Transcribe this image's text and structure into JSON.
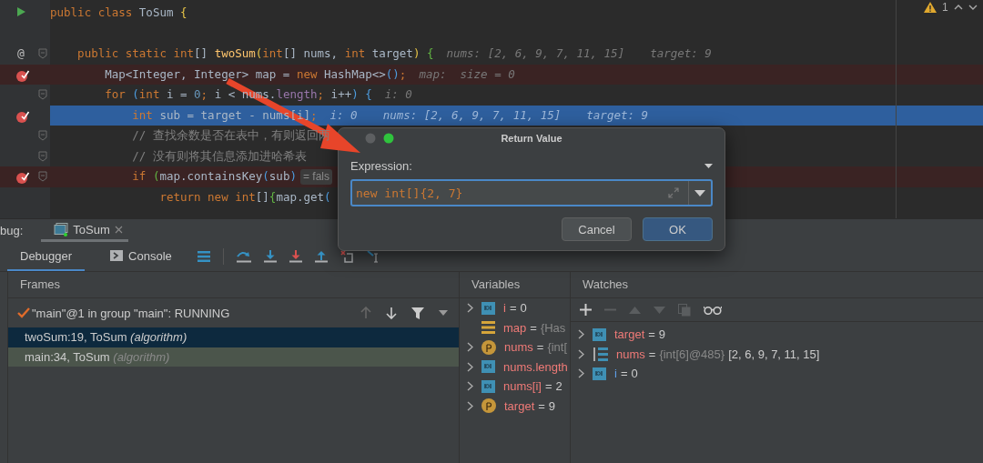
{
  "editor": {
    "warnings": "1",
    "lines": [
      {
        "kind": "plain",
        "marker": {
          "kind": "run"
        },
        "fold": false,
        "segments": [
          {
            "kind": "kw",
            "text": "public class "
          },
          {
            "kind": "plain",
            "text": "ToSum "
          },
          {
            "kind": "y",
            "text": "{"
          }
        ]
      },
      {
        "kind": "plain",
        "fold": false
      },
      {
        "kind": "plain",
        "marker": {
          "kind": "override",
          "text": "@"
        },
        "fold": true,
        "segments": [
          {
            "kind": "kw",
            "text": "    public static int"
          },
          {
            "kind": "plain",
            "text": "[] "
          },
          {
            "kind": "method",
            "text": "twoSum"
          },
          {
            "kind": "y",
            "text": "("
          },
          {
            "kind": "kw",
            "text": "int"
          },
          {
            "kind": "plain",
            "text": "[] nums, "
          },
          {
            "kind": "kw",
            "text": "int "
          },
          {
            "kind": "plain",
            "text": "target"
          },
          {
            "kind": "y",
            "text": ") "
          },
          {
            "kind": "g",
            "text": "{"
          }
        ],
        "hints": [
          "nums: [2, 6, 9, 7, 11, 15]",
          "target: 9"
        ]
      },
      {
        "kind": "breakpoint",
        "marker": {
          "kind": "breakpoint"
        },
        "fold": false,
        "segments": [
          {
            "kind": "plain",
            "text": "        Map<Integer, Integer> map = "
          },
          {
            "kind": "kw",
            "text": "new "
          },
          {
            "kind": "plain",
            "text": "HashMap<>"
          },
          {
            "kind": "b",
            "text": "()"
          },
          {
            "kind": "kw",
            "text": ";"
          }
        ],
        "hints": [
          "map:  size = 0"
        ]
      },
      {
        "kind": "plain",
        "fold": true,
        "segments": [
          {
            "kind": "kw",
            "text": "        for "
          },
          {
            "kind": "b",
            "text": "("
          },
          {
            "kind": "kw",
            "text": "int "
          },
          {
            "kind": "plain",
            "text": "i = "
          },
          {
            "kind": "num",
            "text": "0"
          },
          {
            "kind": "kw",
            "text": "; "
          },
          {
            "kind": "plain",
            "text": "i < nums."
          },
          {
            "kind": "field",
            "text": "length"
          },
          {
            "kind": "kw",
            "text": "; "
          },
          {
            "kind": "plain",
            "text": "i++"
          },
          {
            "kind": "b",
            "text": ") "
          },
          {
            "kind": "b",
            "text": "{"
          }
        ],
        "hints": [
          "i: 0"
        ]
      },
      {
        "kind": "current",
        "marker": {
          "kind": "breakpoint"
        },
        "fold": false,
        "segments": [
          {
            "kind": "kw",
            "text": "            int "
          },
          {
            "kind": "plain",
            "text": "sub = target - nums[i]"
          },
          {
            "kind": "kw",
            "text": ";"
          }
        ],
        "hints": [
          "i: 0",
          "nums: [2, 6, 9, 7, 11, 15]",
          "target: 9"
        ]
      },
      {
        "kind": "plain",
        "fold": true,
        "segments": [
          {
            "kind": "comment",
            "text": "            // 查找余数是否在表中，有则返回两"
          }
        ]
      },
      {
        "kind": "plain",
        "fold": true,
        "segments": [
          {
            "kind": "comment",
            "text": "            // 没有则将其信息添加进哈希表"
          }
        ]
      },
      {
        "kind": "breakpoint",
        "marker": {
          "kind": "breakpoint"
        },
        "fold": true,
        "segments": [
          {
            "kind": "kw",
            "text": "            if "
          },
          {
            "kind": "g",
            "text": "("
          },
          {
            "kind": "plain",
            "text": "map.containsKey"
          },
          {
            "kind": "b",
            "text": "("
          },
          {
            "kind": "plain",
            "text": "sub"
          },
          {
            "kind": "b",
            "text": ")"
          }
        ],
        "badge": "= fals"
      },
      {
        "kind": "plain",
        "fold": false,
        "segments": [
          {
            "kind": "kw",
            "text": "                return new int"
          },
          {
            "kind": "plain",
            "text": "[]"
          },
          {
            "kind": "g",
            "text": "{"
          },
          {
            "kind": "plain",
            "text": "map.get"
          },
          {
            "kind": "b",
            "text": "("
          }
        ]
      }
    ]
  },
  "dialog": {
    "title": "Return Value",
    "label": "Expression:",
    "value": "new int[]{2, 7}",
    "buttons": [
      {
        "label": "Cancel",
        "kind": "secondary"
      },
      {
        "label": "OK",
        "kind": "primary"
      }
    ]
  },
  "debug": {
    "title": "bug:",
    "tab": "ToSum",
    "tabs": [
      {
        "label": "Debugger",
        "selected": true
      },
      {
        "label": "Console",
        "selected": false
      }
    ],
    "frames": {
      "title": "Frames",
      "thread": "\"main\"@1 in group \"main\": RUNNING",
      "items": [
        {
          "method": "twoSum:19, ToSum",
          "package": "(algorithm)",
          "selected": true,
          "highlighted": false
        },
        {
          "method": "main:34, ToSum",
          "package": "(algorithm)",
          "selected": false,
          "highlighted": true
        }
      ]
    },
    "variables": {
      "title": "Variables",
      "items": [
        {
          "kind": "field",
          "name": "i",
          "sep": "=",
          "value": "0",
          "expandable": true
        },
        {
          "kind": "map",
          "name": "map",
          "sep": "=",
          "type": "{Has",
          "expandable": false
        },
        {
          "kind": "param",
          "name": "nums",
          "sep": "=",
          "type": "{int[",
          "expandable": true
        },
        {
          "kind": "field",
          "name": "nums.length",
          "expandable": true
        },
        {
          "kind": "field",
          "name": "nums[i]",
          "sep": "=",
          "value": "2",
          "expandable": true
        },
        {
          "kind": "param",
          "name": "target",
          "sep": "=",
          "value": "9",
          "expandable": true
        }
      ]
    },
    "watches": {
      "title": "Watches",
      "items": [
        {
          "kind": "field",
          "name": "target",
          "sep": "=",
          "value": "9",
          "color": "#ef7a77"
        },
        {
          "kind": "array",
          "name": "nums",
          "sep": "=",
          "type": "{int[6]@485}",
          "value": "[2, 6, 9, 7, 11, 15]",
          "color": "#ef7a77"
        },
        {
          "kind": "field",
          "name": "i",
          "sep": "=",
          "value": "0",
          "color": "#5f9fe8"
        }
      ]
    }
  }
}
